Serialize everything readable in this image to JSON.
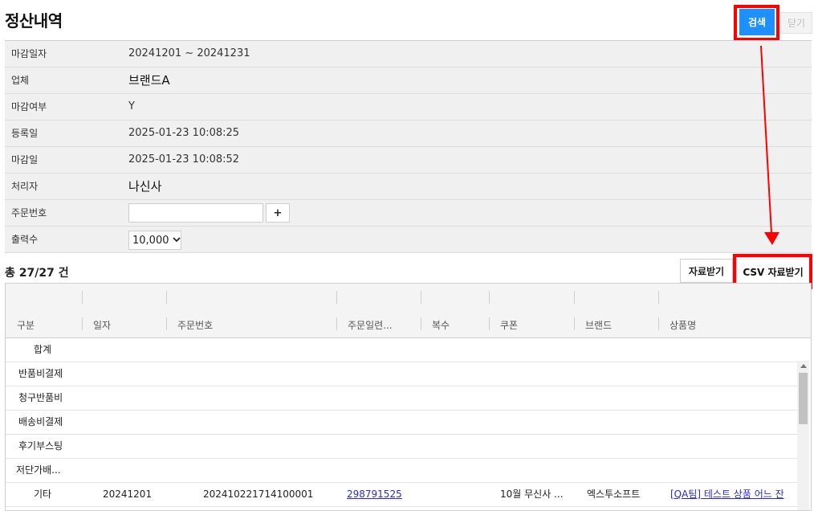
{
  "page": {
    "title": "정산내역"
  },
  "toolbar": {
    "search_label": "검색",
    "close_label": "닫기"
  },
  "form": {
    "rows": [
      {
        "label": "마감일자",
        "value": "20241201 ~ 20241231"
      },
      {
        "label": "업체",
        "value": "브랜드A"
      },
      {
        "label": "마감여부",
        "value": "Y"
      },
      {
        "label": "등록일",
        "value": "2025-01-23 10:08:25"
      },
      {
        "label": "마감일",
        "value": "2025-01-23 10:08:52"
      },
      {
        "label": "처리자",
        "value": "나신사"
      }
    ],
    "order_no": {
      "label": "주문번호",
      "value": "",
      "add_label": "+"
    },
    "output_count": {
      "label": "출력수",
      "selected": "10,000"
    }
  },
  "summary": {
    "total_text": "총 27/27 건"
  },
  "downloads": {
    "download_label": "자료받기",
    "csv_label": "CSV 자료받기"
  },
  "grid": {
    "columns": [
      "구분",
      "일자",
      "주문번호",
      "주문일련...",
      "복수",
      "쿠폰",
      "브랜드",
      "상품명"
    ],
    "rows": [
      {
        "category": "합계"
      },
      {
        "category": "반품비결제"
      },
      {
        "category": "청구반품비"
      },
      {
        "category": "배송비결제"
      },
      {
        "category": "후기부스팅"
      },
      {
        "category": "저단가배..."
      },
      {
        "category": "기타",
        "date": "20241201",
        "order_no": "202410221714100001",
        "order_serial": "298791525",
        "coupon": "10월 무신사 ...",
        "brand": "엑스투소프트",
        "product": "[QA팀] 테스트 상품 어느 잔"
      }
    ]
  },
  "colors": {
    "accent": "#1e90ff",
    "highlight": "#ff0000",
    "link": "#2b2bd6"
  }
}
